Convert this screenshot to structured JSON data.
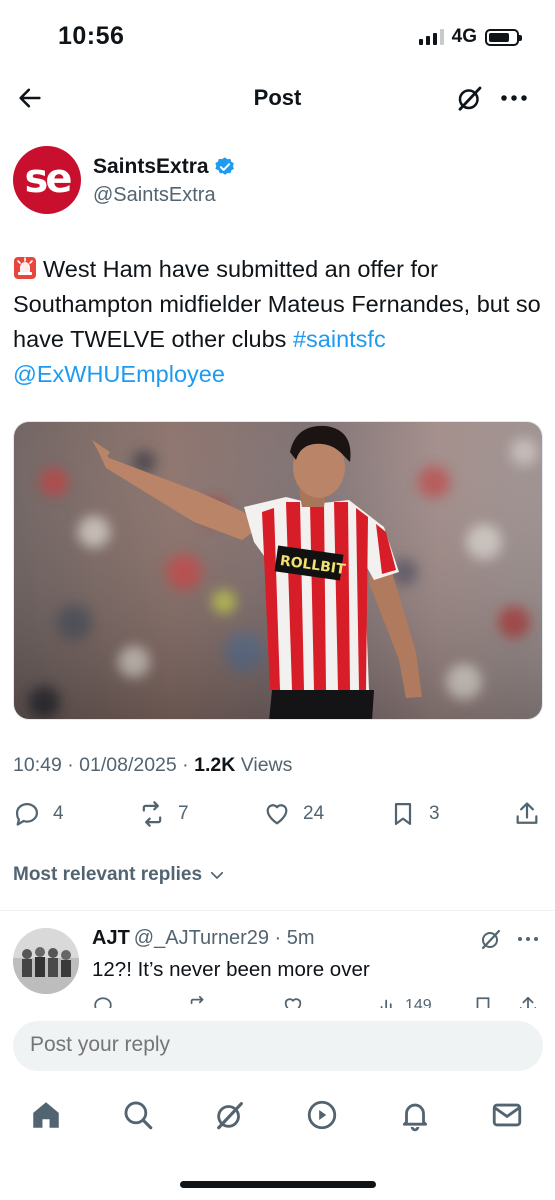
{
  "status_bar": {
    "time": "10:56",
    "network": "4G"
  },
  "header": {
    "title": "Post"
  },
  "post": {
    "author_name": "SaintsExtra",
    "author_handle": "@SaintsExtra",
    "avatar_text": "se",
    "text_main": "West Ham have submitted an offer for Southampton midfielder Mateus Fernandes, but so have TWELVE other clubs ",
    "hashtag": "#saintsfc",
    "mention": "@ExWHUEmployee",
    "sponsor_text": "ROLLBIT",
    "time": "10:49",
    "date": "01/08/2025",
    "views_count": "1.2K",
    "views_label": " Views",
    "sep": " · "
  },
  "actions": {
    "replies": "4",
    "reposts": "7",
    "likes": "24",
    "bookmarks": "3"
  },
  "replies_filter": {
    "label": "Most relevant replies"
  },
  "reply": {
    "name": "AJT",
    "handle": "@_AJTurner29",
    "age": "5m",
    "sep": " · ",
    "text": "12?! It’s never been more over",
    "views": "149"
  },
  "composer": {
    "placeholder": "Post your reply"
  },
  "colors": {
    "accent": "#1d9bf0",
    "brand": "#c8102e",
    "text": "#0f1419",
    "muted": "#536471"
  },
  "icons": [
    "back-arrow-icon",
    "grok-icon",
    "more-icon",
    "verified-icon",
    "siren-icon",
    "reply-icon",
    "repost-icon",
    "like-icon",
    "bookmark-icon",
    "share-icon",
    "chevron-down-icon",
    "views-icon",
    "home-icon",
    "search-icon",
    "play-icon",
    "bell-icon",
    "mail-icon"
  ]
}
